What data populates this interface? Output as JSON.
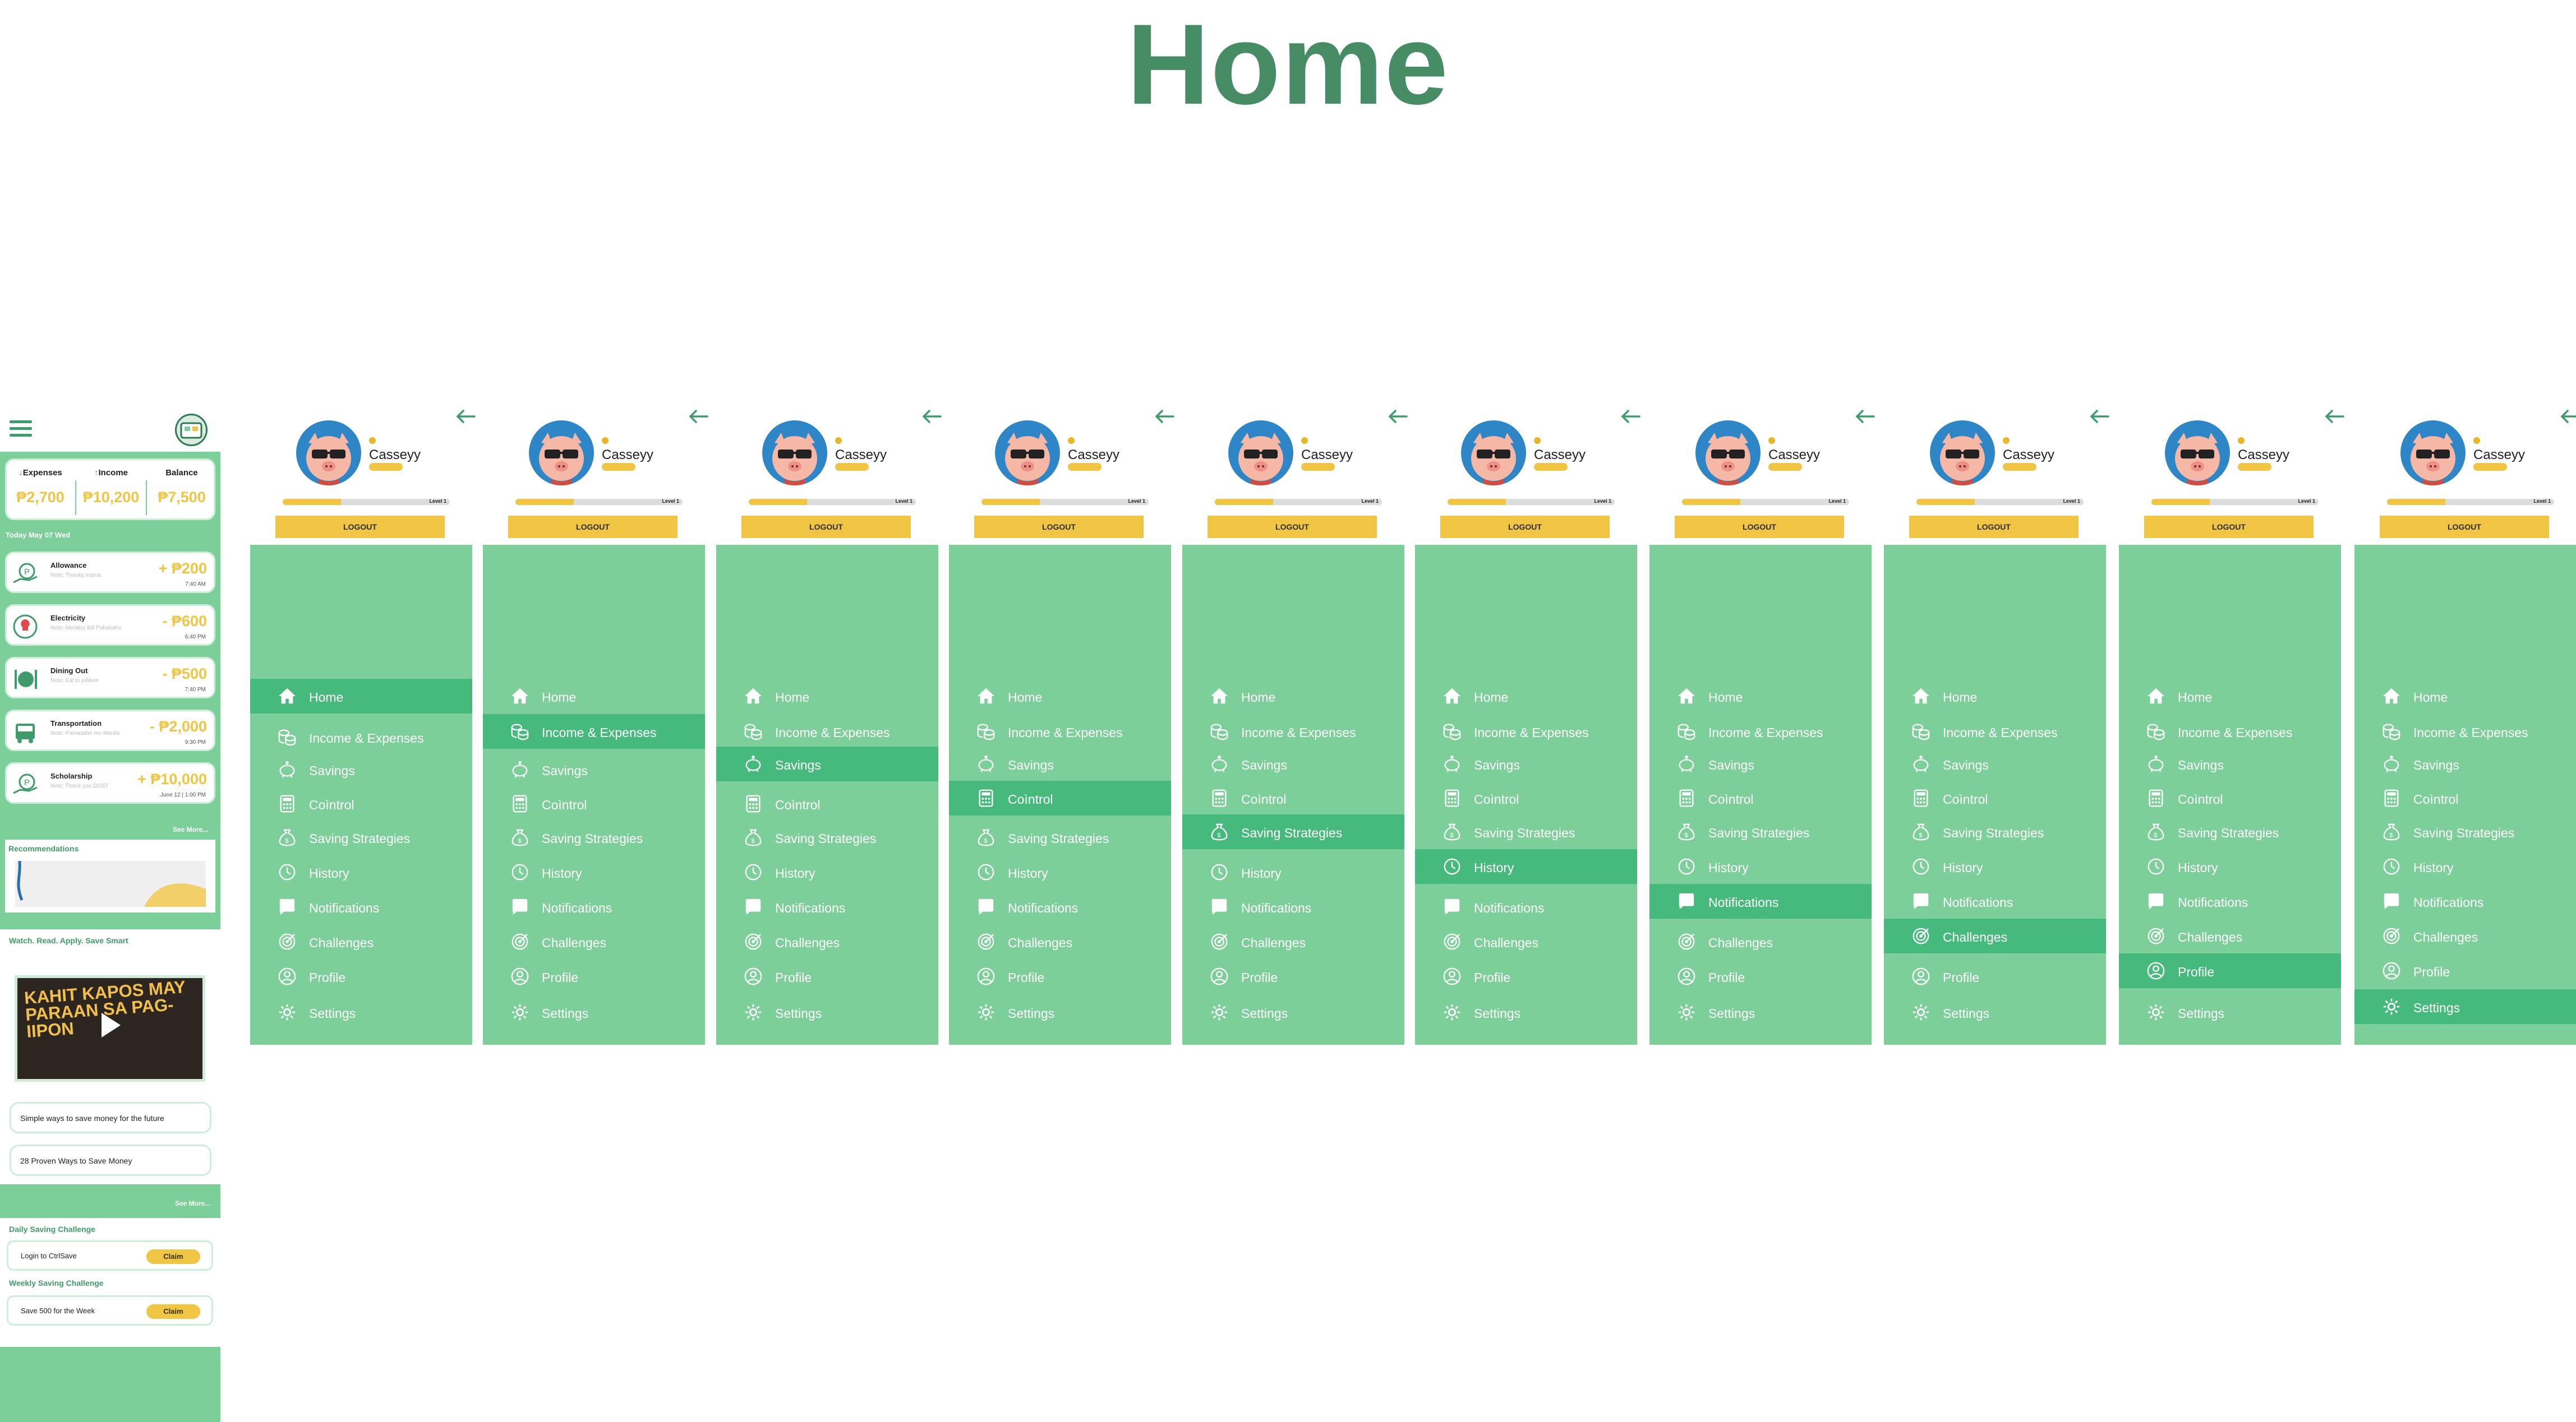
{
  "page": {
    "title": "Home"
  },
  "mobile": {
    "summary": {
      "expenses_label": "Expenses",
      "expenses_value": "₱2,700",
      "income_label": "Income",
      "income_value": "₱10,200",
      "balance_label": "Balance",
      "balance_value": "₱7,500"
    },
    "date_label": "Today May 07 Wed",
    "transactions": [
      {
        "name": "Allowance",
        "note": "Note: Thanks mama",
        "amount": "+ ₱200",
        "time": "7:40 AM",
        "icon": "wallet-hand-icon"
      },
      {
        "name": "Electricity",
        "note": "Note: Meralco Bill Pababaho",
        "amount": "- ₱600",
        "time": "6:40 PM",
        "icon": "lightbulb-icon"
      },
      {
        "name": "Dining Out",
        "note": "Note: Eat in jollibee",
        "amount": "- ₱500",
        "time": "7:40 PM",
        "icon": "fork-knife-icon"
      },
      {
        "name": "Transportation",
        "note": "Note: Pamasahe mo Manila",
        "amount": "- ₱2,000",
        "time": "9:30 PM",
        "icon": "bus-icon"
      },
      {
        "name": "Scholarship",
        "note": "Note: Thank you DOST",
        "amount": "+ ₱10,000",
        "time": "June 12 | 1:00 PM",
        "icon": "wallet-hand-icon"
      }
    ],
    "see_more_1": "See More...",
    "recommendations_label": "Recommendations",
    "watch_label": "Watch. Read. Apply. Save Smart",
    "video_title": "KAHIT KAPOS MAY PARAAN SA PAG-IIPON",
    "articles": [
      "Simple ways to save money for the future",
      "28 Proven Ways to Save Money"
    ],
    "see_more_2": "See More...",
    "daily_label": "Daily Saving Challenge",
    "daily_task": "Login to CtrlSave",
    "weekly_label": "Weekly Saving Challenge",
    "weekly_task": "Save 500 for the Week",
    "claim_label": "Claim"
  },
  "sidebar": {
    "username": "Casseyy",
    "level_label": "Level 1",
    "xp_fraction": 0.35,
    "logout_label": "LOGOUT",
    "items": [
      {
        "label": "Home",
        "icon": "home-icon"
      },
      {
        "label": "Income & Expenses",
        "icon": "coins-icon"
      },
      {
        "label": "Savings",
        "icon": "piggy-bank-icon"
      },
      {
        "label": "Coìntrol",
        "icon": "calculator-icon"
      },
      {
        "label": "Saving Strategies",
        "icon": "money-bag-icon"
      },
      {
        "label": "History",
        "icon": "clock-icon"
      },
      {
        "label": "Notifications",
        "icon": "chat-bubble-icon"
      },
      {
        "label": "Challenges",
        "icon": "target-icon"
      },
      {
        "label": "Profile",
        "icon": "user-icon"
      },
      {
        "label": "Settings",
        "icon": "gear-icon"
      }
    ]
  },
  "colors": {
    "accent_green": "#468d66",
    "menu_green": "#7ccf99",
    "active_green": "#46b97c",
    "gold": "#f0c544"
  }
}
